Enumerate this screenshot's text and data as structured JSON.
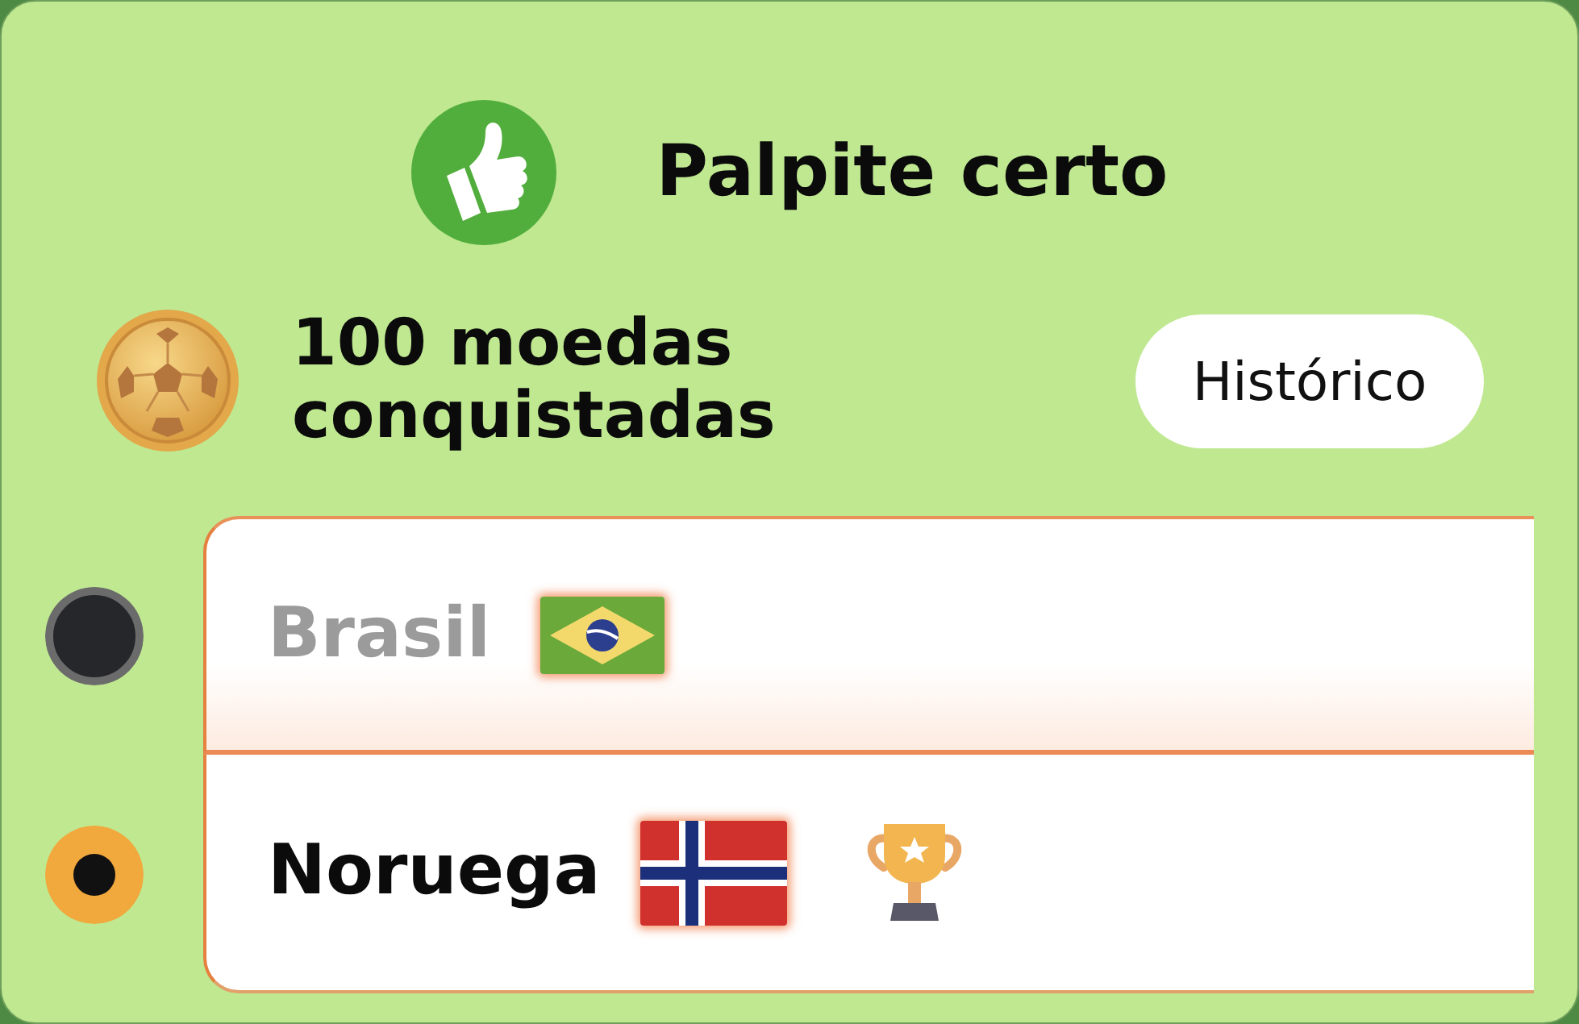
{
  "header": {
    "title": "Palpite certo"
  },
  "reward": {
    "text": "100 moedas conquistadas",
    "button": "Histórico"
  },
  "options": [
    {
      "team": "Brasil",
      "kind": "brazil",
      "selected": false,
      "winner": false
    },
    {
      "team": "Noruega",
      "kind": "norway",
      "selected": true,
      "winner": true
    }
  ]
}
